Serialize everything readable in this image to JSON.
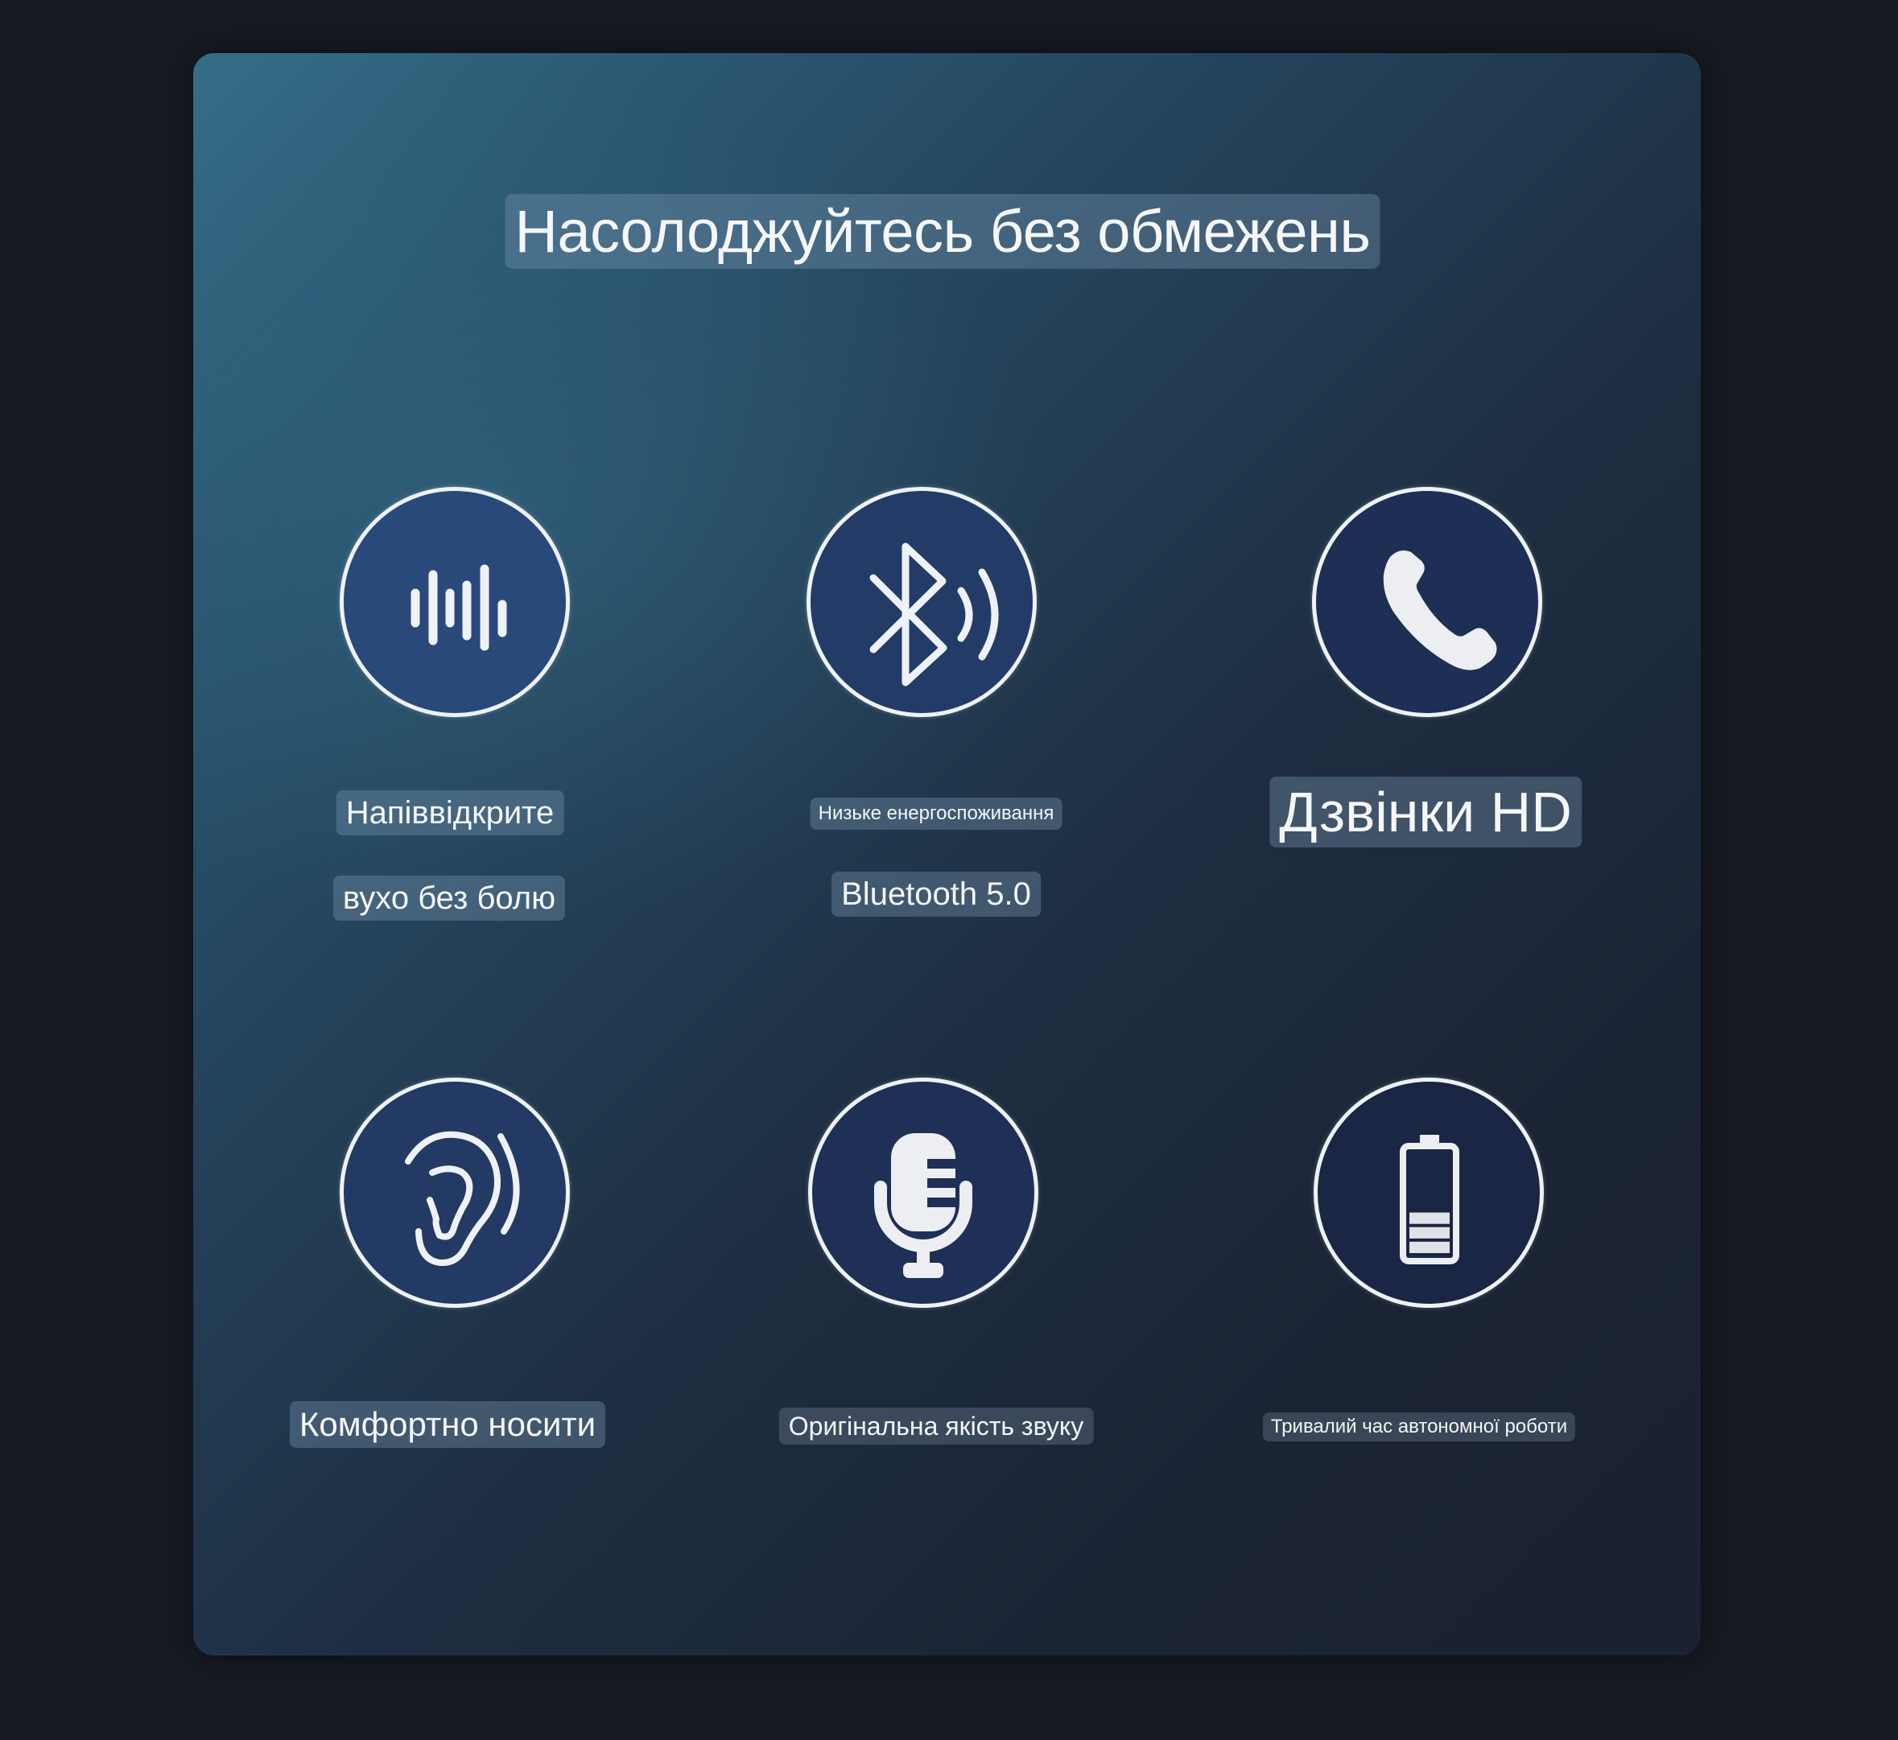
{
  "page": {
    "title": "Насолоджуйтесь без обмежень",
    "colors": {
      "page_background": "#161a22",
      "panel_gradient_start": "#356d86",
      "panel_gradient_end": "#1a2131",
      "icon_ring": "#eef1f5",
      "icon_glyph": "#eef1f5",
      "label_pill": "#78 96 af (translucent)",
      "text": "#f4f6f8"
    }
  },
  "features": [
    {
      "icon": "sound-wave-icon",
      "lines": [
        "Напіввідкрите",
        "вухо без болю"
      ]
    },
    {
      "icon": "bluetooth-signal-icon",
      "lines": [
        "Низьке енергоспоживання",
        "Bluetooth 5.0"
      ]
    },
    {
      "icon": "phone-icon",
      "lines": [
        "Дзвінки HD"
      ]
    },
    {
      "icon": "ear-icon",
      "lines": [
        "Комфортно носити"
      ]
    },
    {
      "icon": "microphone-icon",
      "lines": [
        "Оригінальна якість звуку"
      ]
    },
    {
      "icon": "battery-icon",
      "lines": [
        "Тривалий час автономної роботи"
      ],
      "battery_level": 0.43
    }
  ]
}
